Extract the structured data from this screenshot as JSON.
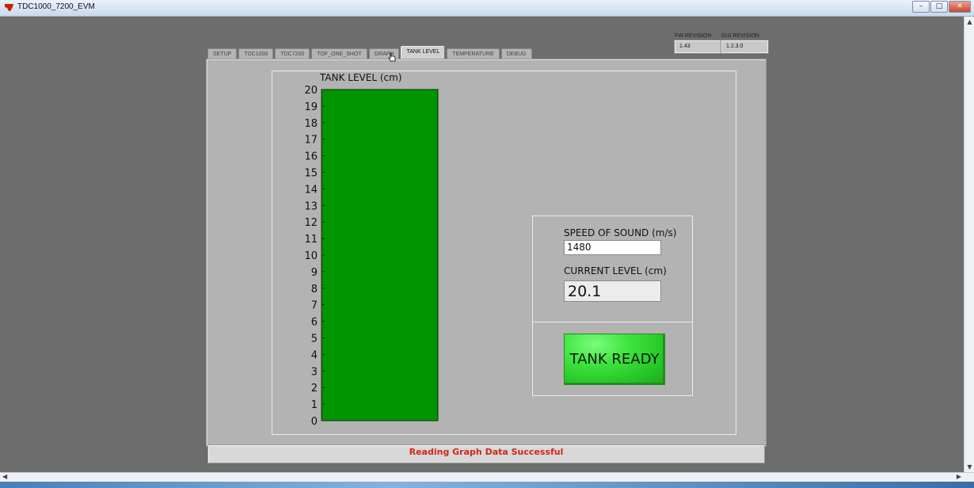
{
  "window": {
    "title": "TDC1000_7200_EVM",
    "minimize_glyph": "–",
    "maximize_glyph": "□",
    "close_glyph": "✕"
  },
  "tabs": [
    {
      "label": "SETUP",
      "active": false
    },
    {
      "label": "TDC1000",
      "active": false
    },
    {
      "label": "TDC7200",
      "active": false
    },
    {
      "label": "TOF_ONE_SHOT",
      "active": false
    },
    {
      "label": "GRAPH",
      "active": false
    },
    {
      "label": "TANK LEVEL",
      "active": true
    },
    {
      "label": "TEMPERATURE",
      "active": false
    },
    {
      "label": "DEBUG",
      "active": false
    }
  ],
  "revisions": {
    "fw_label": "FW REVISION",
    "fw_value": "1.43",
    "gui_label": "GUI REVISION",
    "gui_value": "1.2.3.0"
  },
  "chart_data": {
    "type": "bar",
    "title": "TANK LEVEL (cm)",
    "ylim": [
      0,
      20
    ],
    "yticks": [
      0,
      1,
      2,
      3,
      4,
      5,
      6,
      7,
      8,
      9,
      10,
      11,
      12,
      13,
      14,
      15,
      16,
      17,
      18,
      19,
      20
    ],
    "value": 20.1,
    "fill_color": "#009400"
  },
  "controls": {
    "speed_label": "SPEED OF SOUND (m/s)",
    "speed_value": "1480",
    "level_label": "CURRENT LEVEL (cm)",
    "level_value": "20.1",
    "tank_ready_label": "TANK READY",
    "tank_ready_color": "#3fe43f"
  },
  "status": {
    "message": "Reading Graph Data Successful",
    "color": "#d0281a"
  }
}
